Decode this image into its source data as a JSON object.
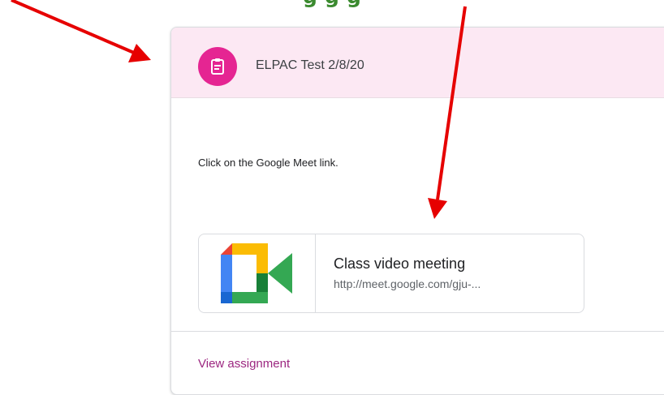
{
  "caption": "g          g          g",
  "card": {
    "title": "ELPAC Test 2/8/20",
    "icon": "assignment-icon",
    "accent_color": "#e52592",
    "header_bg": "#fce8f3",
    "instructions": "Click on the Google Meet link.",
    "meet_link": {
      "title": "Class video meeting",
      "url": "http://meet.google.com/gju-...",
      "icon": "google-meet-logo-icon"
    },
    "view_assignment": "View assignment"
  },
  "annotation_color": "#e60000"
}
